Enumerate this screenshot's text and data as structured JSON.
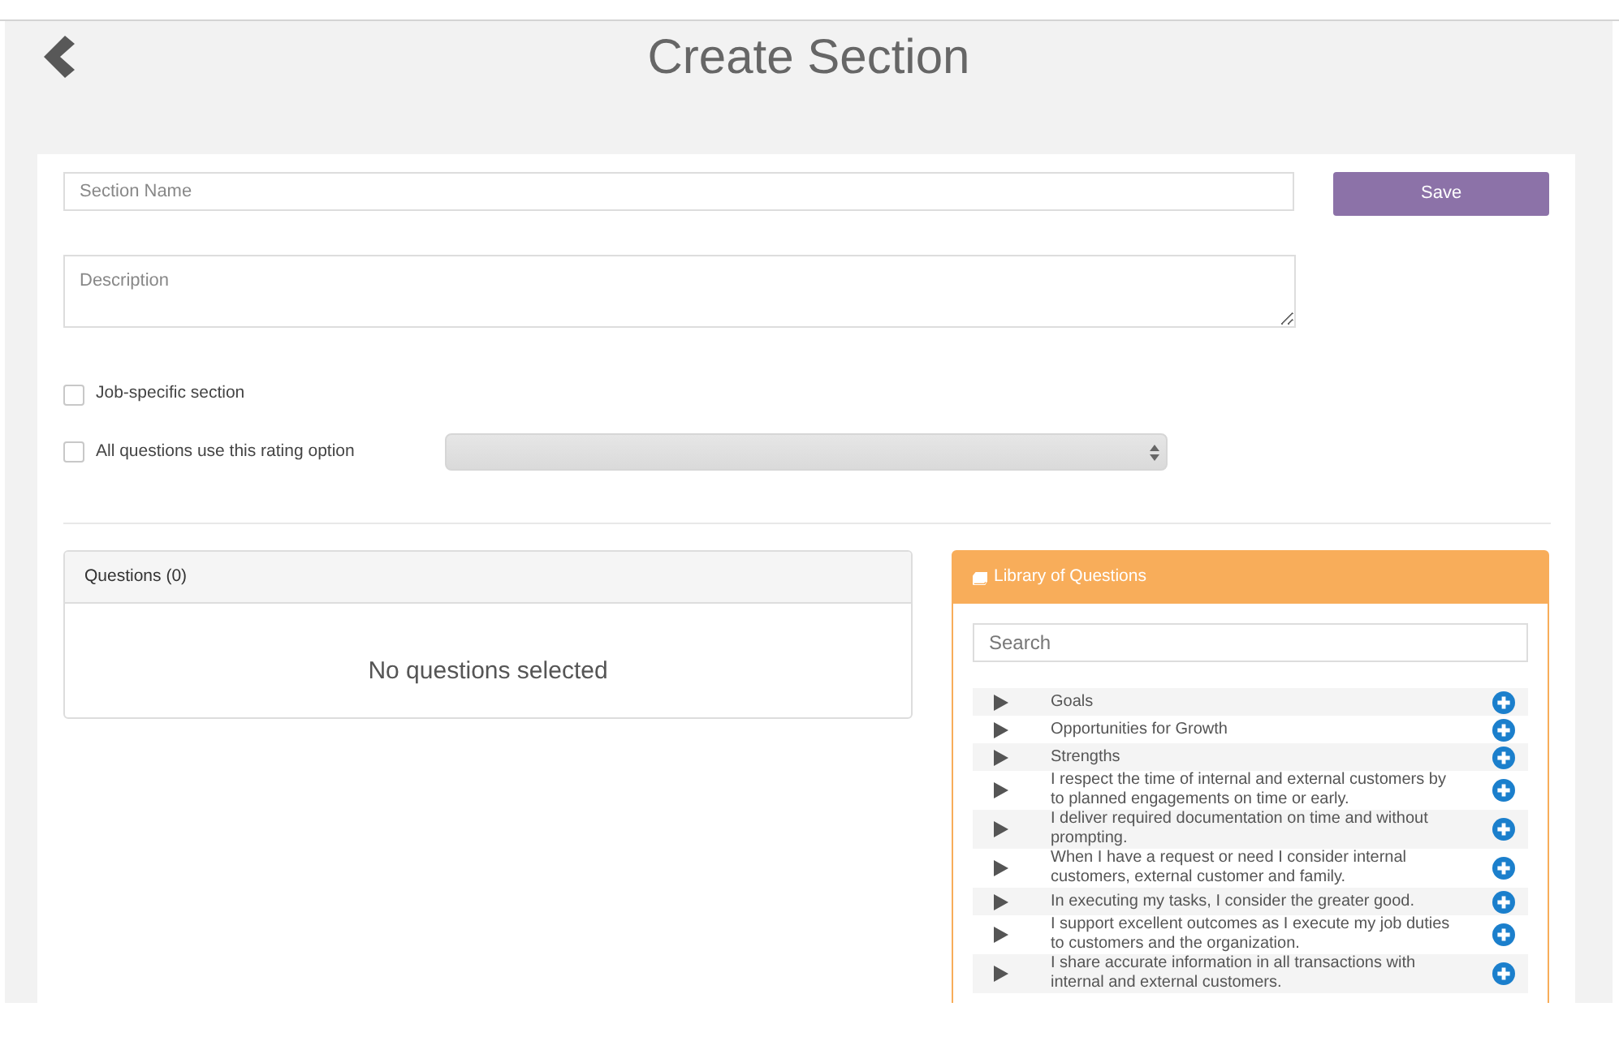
{
  "page": {
    "title": "Create Section"
  },
  "form": {
    "section_name": {
      "placeholder": "Section Name"
    },
    "save_button": "Save",
    "description": {
      "placeholder": "Description"
    },
    "options": [
      {
        "kind": "checkbox",
        "label": "Job-specific section",
        "checked": false
      },
      {
        "kind": "checkbox_select",
        "label": "All questions use this rating option",
        "checked": false
      }
    ]
  },
  "questions_panel": {
    "title": "Questions (0)",
    "empty_message": "No questions selected"
  },
  "library": {
    "title": "Library of Questions",
    "search": {
      "placeholder": "Search"
    },
    "items": [
      {
        "text": "Goals",
        "expanded": false
      },
      {
        "text": "Opportunities for Growth",
        "expanded": false
      },
      {
        "text": "Strengths",
        "expanded": false
      },
      {
        "text": "I respect the time of internal and external customers by to planned engagements on time or early.",
        "expanded": false
      },
      {
        "text": "I deliver required documentation on time and without prompting.",
        "expanded": false
      },
      {
        "text": "When I have a request or need I consider internal customers, external customer and family.",
        "expanded": false
      },
      {
        "text": "In executing my tasks, I consider the greater good.",
        "expanded": false
      },
      {
        "text": "I support excellent outcomes as I execute my job duties to customers and the organization.",
        "expanded": false
      },
      {
        "text": "I share accurate information in all transactions with internal and external customers.",
        "expanded": false
      }
    ]
  }
}
